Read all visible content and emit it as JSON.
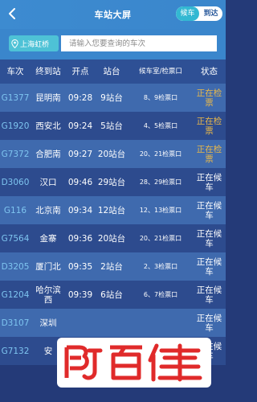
{
  "header": {
    "title": "车站大屏",
    "back_icon": "chevron-left-icon"
  },
  "toggle": {
    "options": [
      "候车",
      "到达"
    ],
    "selected": "候车"
  },
  "search": {
    "station": "上海虹桥",
    "placeholder": "请输入您要查询的车次",
    "value": ""
  },
  "table": {
    "columns": [
      "车次",
      "终到站",
      "开点",
      "站台",
      "候车室/检票口",
      "状态"
    ],
    "rows": [
      {
        "train": "G1377",
        "dest": "昆明南",
        "time": "09:28",
        "platform": "9站台",
        "gate": "8、9检票口",
        "status": "正在检票",
        "status_type": "check",
        "shade": "light"
      },
      {
        "train": "G1920",
        "dest": "西安北",
        "time": "09:24",
        "platform": "5站台",
        "gate": "4、5检票口",
        "status": "正在检票",
        "status_type": "check",
        "shade": "dark"
      },
      {
        "train": "G7372",
        "dest": "合肥南",
        "time": "09:27",
        "platform": "20站台",
        "gate": "20、21检票口",
        "status": "正在检票",
        "status_type": "check",
        "shade": "light"
      },
      {
        "train": "D3060",
        "dest": "汉口",
        "time": "09:46",
        "platform": "29站台",
        "gate": "28、29检票口",
        "status": "正在候车",
        "status_type": "wait",
        "shade": "dark"
      },
      {
        "train": "G116",
        "dest": "北京南",
        "time": "09:34",
        "platform": "12站台",
        "gate": "12、13检票口",
        "status": "正在候车",
        "status_type": "wait",
        "shade": "light"
      },
      {
        "train": "G7564",
        "dest": "金寨",
        "time": "09:36",
        "platform": "20站台",
        "gate": "20、21检票口",
        "status": "正在候车",
        "status_type": "wait",
        "shade": "dark"
      },
      {
        "train": "D3205",
        "dest": "厦门北",
        "time": "09:35",
        "platform": "2站台",
        "gate": "2、3检票口",
        "status": "正在候车",
        "status_type": "wait",
        "shade": "light"
      },
      {
        "train": "G1204",
        "dest": "哈尔滨西",
        "time": "09:39",
        "platform": "6站台",
        "gate": "6、7检票口",
        "status": "正在候车",
        "status_type": "wait",
        "shade": "dark"
      },
      {
        "train": "D3107",
        "dest": "深圳",
        "time": "",
        "platform": "",
        "gate": "",
        "status": "正在候车",
        "status_type": "wait",
        "shade": "light"
      },
      {
        "train": "G7132",
        "dest": "安",
        "time": "",
        "platform": "",
        "gate": "",
        "status": "正在候车",
        "status_type": "wait",
        "shade": "dark"
      }
    ]
  },
  "colors": {
    "row_light": "#3f6aae",
    "row_dark": "#2d4b8e",
    "header_bg": "#3a86cc",
    "status_check": "#e9b84a"
  },
  "watermark": {
    "brand_text": "百佳",
    "logo": "bj-logo"
  }
}
